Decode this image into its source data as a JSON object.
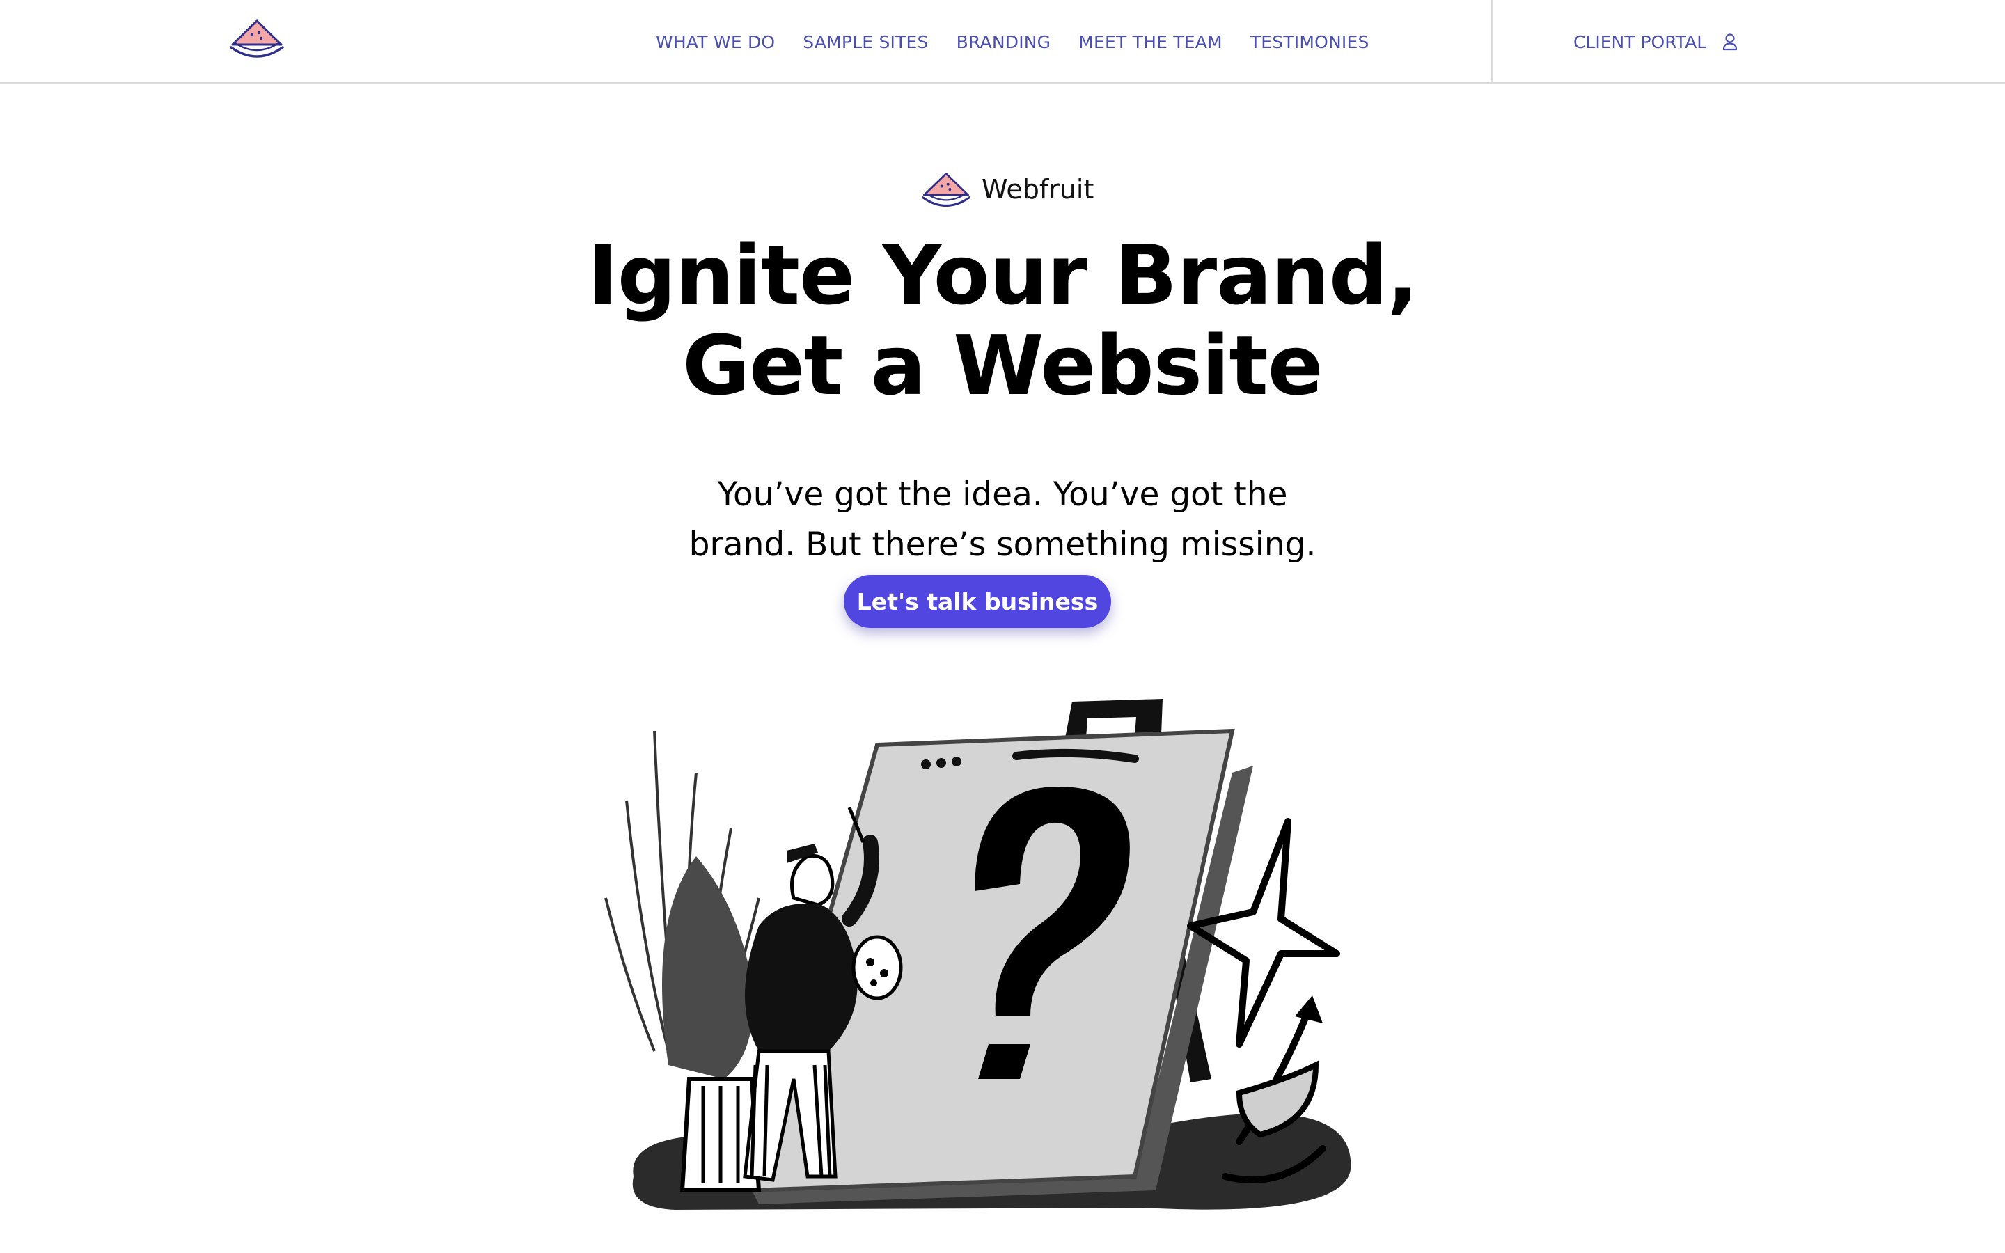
{
  "header": {
    "logo_icon": "watermelon-slice-icon",
    "nav": [
      {
        "label": "WHAT WE DO"
      },
      {
        "label": "SAMPLE SITES"
      },
      {
        "label": "BRANDING"
      },
      {
        "label": "MEET THE TEAM"
      },
      {
        "label": "TESTIMONIES"
      }
    ],
    "portal_label": "CLIENT PORTAL",
    "portal_icon": "user-icon"
  },
  "hero": {
    "brand_icon": "watermelon-slice-icon",
    "brand_name": "Webfruit",
    "title_line1": "Ignite Your Brand,",
    "title_line2": "Get a Website",
    "subtitle_line1": "You’ve got the idea. You’ve got the",
    "subtitle_line2": "brand. But there’s something missing.",
    "cta_label": "Let's talk business",
    "illustration": "painter-with-question-mark-canvas-illustration"
  },
  "colors": {
    "accent": "#5146e0",
    "nav_text": "#4a4fb0",
    "logo_outline": "#2f2f8a",
    "logo_fill": "#f4a7a7",
    "divider": "#dcdcdc"
  }
}
